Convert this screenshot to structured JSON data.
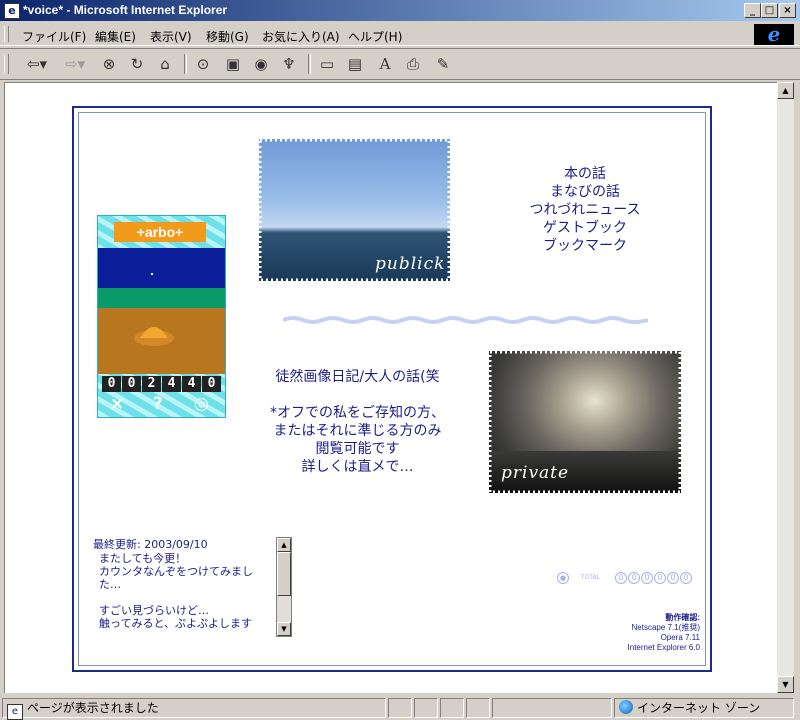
{
  "window": {
    "title": "*voice* - Microsoft Internet Explorer"
  },
  "menu": [
    "ファイル(F)",
    "編集(E)",
    "表示(V)",
    "移動(G)",
    "お気に入り(A)",
    "ヘルプ(H)"
  ],
  "toolbar_icons": [
    "back-icon",
    "forward-icon",
    "stop-icon",
    "refresh-icon",
    "home-icon",
    "search-icon",
    "favorites-icon",
    "media-icon",
    "history-icon",
    "mail-icon",
    "edit-icon",
    "print-icon",
    "discuss-icon"
  ],
  "nav_links": [
    "本の話",
    "まなびの話",
    "つれづれニュース",
    "ゲストブック",
    "ブックマーク"
  ],
  "photos": {
    "public_caption": "publick",
    "private_caption": "private"
  },
  "diary": {
    "title": "徒然画像日記/大人の話(笑",
    "note_lines": [
      "*オフでの私をご存知の方、",
      "またはそれに準じる方のみ",
      "閲覧可能です",
      "詳しくは直メで…"
    ]
  },
  "gadget": {
    "brand": "+arbo+",
    "counter": [
      "0",
      "0",
      "2",
      "4",
      "4",
      "0"
    ],
    "controls": [
      "×",
      "?",
      "◎"
    ]
  },
  "update": {
    "label": "最終更新: 2003/09/10",
    "lines": [
      "またしても今更！",
      "カウンタなんぞをつけてみまし",
      "た…",
      "",
      "すごい見づらいけど…",
      "触ってみると、ぷよぷよします"
    ]
  },
  "small_counter": {
    "label": "TOTAL",
    "digits": [
      "0",
      "0",
      "0",
      "0",
      "0",
      "0"
    ]
  },
  "browsers": {
    "heading": "動作確認:",
    "lines": [
      "Netscape 7.1(推奨)",
      "Opera 7.11",
      "Internet Explorer 6.0"
    ]
  },
  "status": {
    "text": "ページが表示されました",
    "zone": "インターネット ゾーン"
  },
  "colors": {
    "accent": "#1c1c8c",
    "frame": "#1c2a8a"
  }
}
